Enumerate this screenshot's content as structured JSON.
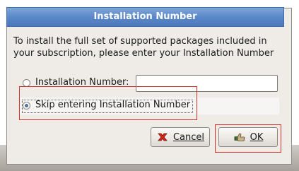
{
  "dialog": {
    "title": "Installation Number",
    "message": "To install the full set of supported packages included in your subscription, please enter your Installation Number",
    "options": {
      "installation_number_label": "Installation Number:",
      "installation_number_value": "",
      "skip_label": "Skip entering Installation Number",
      "selected": "skip"
    },
    "buttons": {
      "cancel_label": "Cancel",
      "ok_label": "OK"
    }
  },
  "icons": {
    "cancel": "cancel-x-icon",
    "ok": "ok-hand-icon"
  },
  "colors": {
    "title_bar": "#5b88c8",
    "highlight_annotation": "#d4312a",
    "radio_selected": "#4a6f9f"
  }
}
